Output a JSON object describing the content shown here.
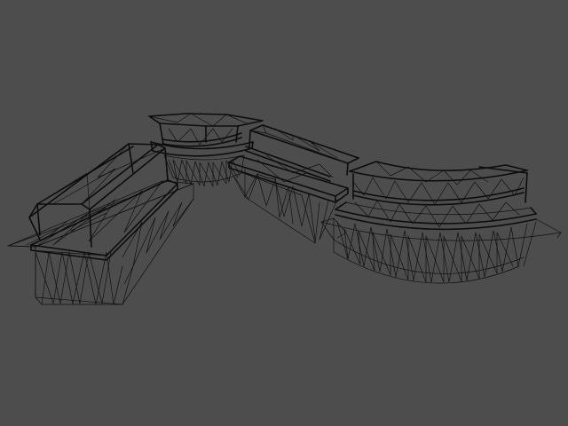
{
  "viewport": {
    "background_color": "#4d4d4d",
    "wire_color": "#111111",
    "render_mode": "wireframe"
  },
  "scene": {
    "model": "curved-counter-wireframe",
    "segments": [
      "left-counter-with-glass-canopy",
      "curved-back-counter",
      "middle-straight-counter",
      "right-curved-display-counter"
    ]
  }
}
